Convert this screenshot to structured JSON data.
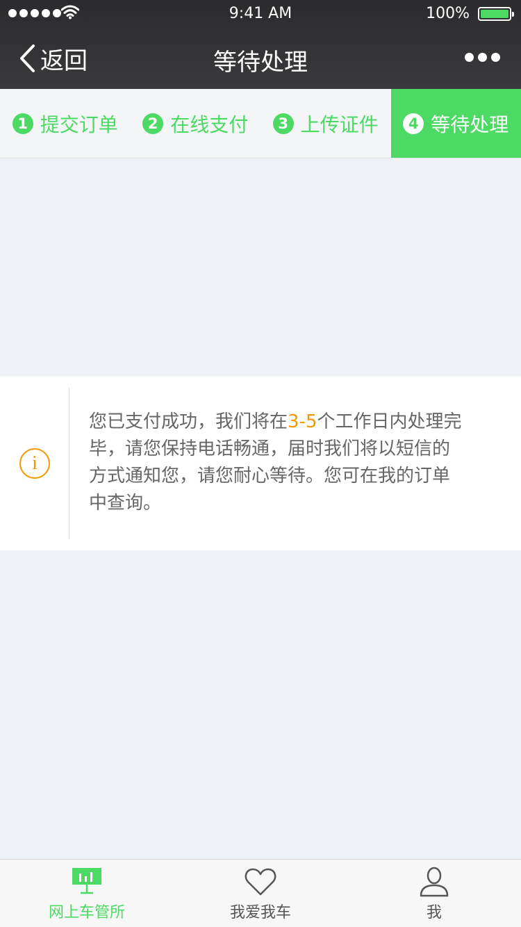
{
  "status_bar": {
    "time": "9:41 AM",
    "battery": "100%"
  },
  "nav": {
    "back_label": "返回",
    "title": "等待处理"
  },
  "steps": [
    {
      "num": "1",
      "label": "提交订单",
      "active": false
    },
    {
      "num": "2",
      "label": "在线支付",
      "active": false
    },
    {
      "num": "3",
      "label": "上传证件",
      "active": false
    },
    {
      "num": "4",
      "label": "等待处理",
      "active": true
    }
  ],
  "info": {
    "text_before": "您已支付成功，我们将在",
    "highlight": "3-5",
    "text_after": "个工作日内处理完毕，请您保持电话畅通，届时我们将以短信的方式通知您，请您耐心等待。您可在我的订单中查询。",
    "highlight_color": "#f39800"
  },
  "tabs": [
    {
      "label": "网上车管所",
      "icon": "presentation-chart-icon",
      "active": true
    },
    {
      "label": "我爱我车",
      "icon": "heart-icon",
      "active": false
    },
    {
      "label": "我",
      "icon": "user-icon",
      "active": false
    }
  ],
  "colors": {
    "accent": "#4cd964",
    "header_bg": "#333335",
    "page_bg": "#eef1f6",
    "warning": "#f39800"
  }
}
